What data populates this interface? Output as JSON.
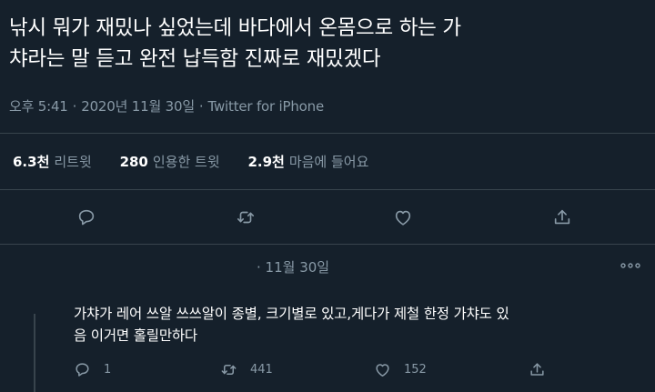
{
  "tweet": {
    "text": "낚시 뭐가 재밌나 싶었는데 바다에서 온몸으로 하는 가\n챠라는 말 듣고 완전 납득함 진짜로 재밌겠다",
    "time": "오후 5:41",
    "separator": "·",
    "date": "2020년 11월 30일",
    "source": "Twitter for iPhone"
  },
  "stats": {
    "retweets_count": "6.3천",
    "retweets_label": "리트윗",
    "quotes_count": "280",
    "quotes_label": "인용한 트윗",
    "likes_count": "2.9천",
    "likes_label": "마음에 들어요"
  },
  "actions": [
    "reply-icon",
    "retweet-icon",
    "like-icon",
    "share-icon"
  ],
  "reply": {
    "time": "· 11월 30일",
    "text": "가챠가 레어 쓰알 쓰쓰알이 종별, 크기별로 있고,게다가 제철 한정 가챠도 있\n음 이거면 홀릴만하다",
    "replies": "1",
    "retweets": "441",
    "likes": "152"
  },
  "colors": {
    "background": "#15202b",
    "text": "#ffffff",
    "secondary": "#8899a6",
    "border": "#38444d"
  }
}
